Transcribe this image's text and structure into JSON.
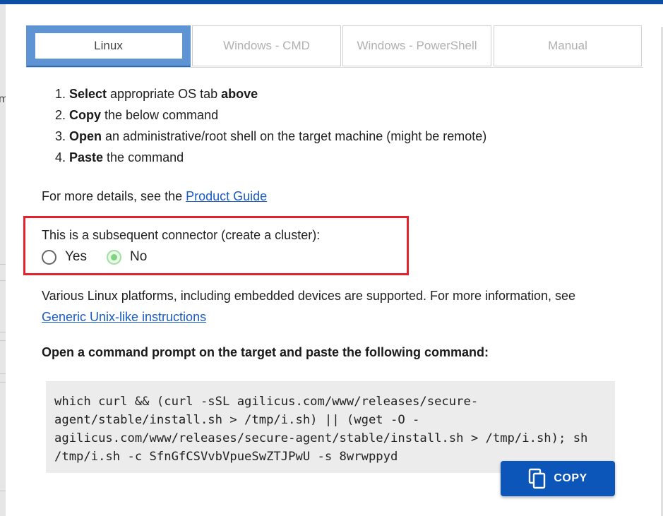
{
  "tabs": [
    {
      "label": "Linux",
      "active": true
    },
    {
      "label": "Windows - CMD",
      "active": false
    },
    {
      "label": "Windows - PowerShell",
      "active": false
    },
    {
      "label": "Manual",
      "active": false
    }
  ],
  "steps": [
    {
      "num": "1.",
      "parts": [
        {
          "b": "Select"
        },
        {
          "t": " appropriate OS tab "
        },
        {
          "b": "above"
        }
      ]
    },
    {
      "num": "2.",
      "parts": [
        {
          "b": "Copy"
        },
        {
          "t": " the below command"
        }
      ]
    },
    {
      "num": "3.",
      "parts": [
        {
          "b": "Open"
        },
        {
          "t": " an administrative/root shell on the target machine (might be remote)"
        }
      ]
    },
    {
      "num": "4.",
      "parts": [
        {
          "b": "Paste"
        },
        {
          "t": " the command"
        }
      ]
    }
  ],
  "details": {
    "prefix": "For more details, see the ",
    "link": "Product Guide"
  },
  "cluster": {
    "label": "This is a subsequent connector (create a cluster):",
    "options": [
      {
        "label": "Yes",
        "checked": false
      },
      {
        "label": "No",
        "checked": true
      }
    ]
  },
  "linux_info": {
    "text": "Various Linux platforms, including embedded devices are supported. For more information, see ",
    "link": "Generic Unix-like instructions"
  },
  "command_title": "Open a command prompt on the target and paste the following command:",
  "command_lines": [
    "which curl && (curl -sSL agilicus.com/www/releases/secure-",
    "agent/stable/install.sh > /tmp/i.sh) || (wget -O -",
    "agilicus.com/www/releases/secure-agent/stable/install.sh > /tmp/i.sh); sh",
    "/tmp/i.sh -c SfnGfCSVvbVpueSwZTJPwU -s 8wrwppyd"
  ],
  "copy_label": "COPY",
  "icons": {
    "copy": "content-copy-icon"
  },
  "colors": {
    "accent": "#0b56b8",
    "active_tab": "#5e94d4",
    "highlight_border": "#e5212b",
    "radio_checked": "#7fd37f"
  }
}
